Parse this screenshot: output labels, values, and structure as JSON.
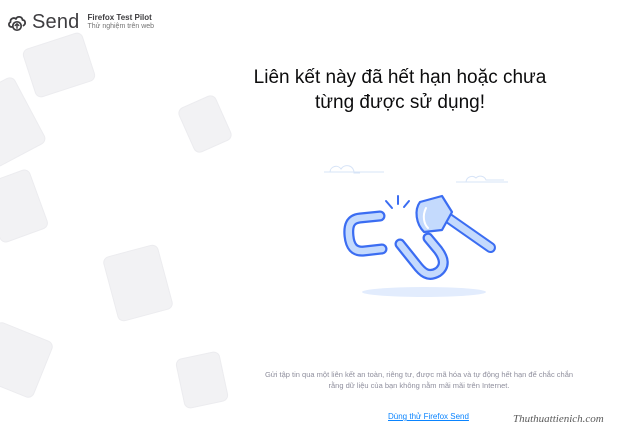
{
  "header": {
    "logo_text": "Send",
    "pilot_title": "Firefox Test Pilot",
    "pilot_subtitle": "Thử nghiệm trên web"
  },
  "main": {
    "headline_line1": "Liên kết này đã hết hạn hoặc chưa",
    "headline_line2": "từng được sử dụng!",
    "description_line1": "Gửi tập tin qua một liên kết an toàn, riêng tư, được mã hóa và tự động hết hạn để chắc chắn",
    "description_line2": "rằng dữ liệu của bạn không nằm mãi mãi trên Internet.",
    "cta_link": "Dùng thử Firefox Send"
  },
  "watermark": "Thuthuattienich.com",
  "colors": {
    "accent": "#0a84ff",
    "illustration_blue": "#3b6df2",
    "illustration_light": "#c4dafd",
    "text_muted": "#8f8f9d"
  },
  "icons": {
    "logo": "cloud-upload-icon",
    "illustration": "broken-link-axe-illustration"
  }
}
